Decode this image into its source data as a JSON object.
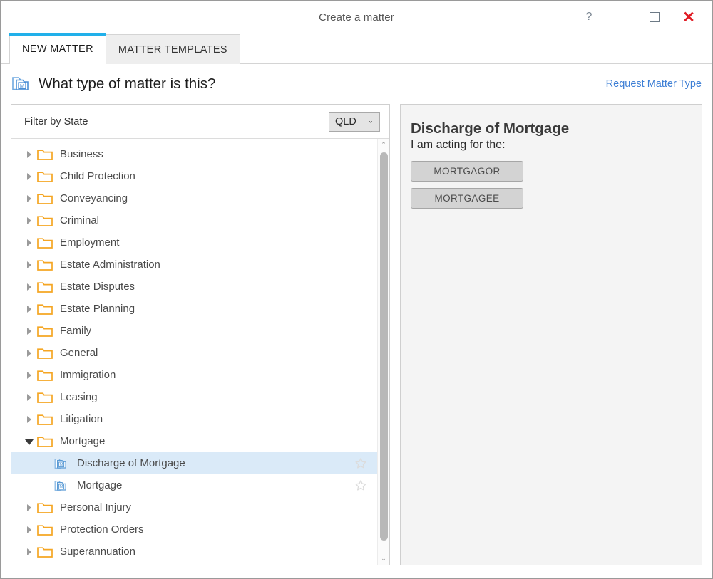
{
  "window": {
    "title": "Create a matter",
    "controls": {
      "help": "?",
      "minimize": "_",
      "maximize": "",
      "close": "✕"
    }
  },
  "tabs": [
    {
      "label": "NEW MATTER",
      "active": true
    },
    {
      "label": "MATTER TEMPLATES",
      "active": false
    }
  ],
  "header": {
    "icon": "matter-folder-icon",
    "title": "What type of matter is this?",
    "link": "Request Matter Type"
  },
  "filter": {
    "label": "Filter by State",
    "selected_state": "QLD",
    "chevron": "⌄"
  },
  "tree": {
    "items": [
      {
        "label": "Business",
        "type": "folder",
        "expanded": false,
        "level": 0
      },
      {
        "label": "Child Protection",
        "type": "folder",
        "expanded": false,
        "level": 0
      },
      {
        "label": "Conveyancing",
        "type": "folder",
        "expanded": false,
        "level": 0
      },
      {
        "label": "Criminal",
        "type": "folder",
        "expanded": false,
        "level": 0
      },
      {
        "label": "Employment",
        "type": "folder",
        "expanded": false,
        "level": 0
      },
      {
        "label": "Estate Administration",
        "type": "folder",
        "expanded": false,
        "level": 0
      },
      {
        "label": "Estate Disputes",
        "type": "folder",
        "expanded": false,
        "level": 0
      },
      {
        "label": "Estate Planning",
        "type": "folder",
        "expanded": false,
        "level": 0
      },
      {
        "label": "Family",
        "type": "folder",
        "expanded": false,
        "level": 0
      },
      {
        "label": "General",
        "type": "folder",
        "expanded": false,
        "level": 0
      },
      {
        "label": "Immigration",
        "type": "folder",
        "expanded": false,
        "level": 0
      },
      {
        "label": "Leasing",
        "type": "folder",
        "expanded": false,
        "level": 0
      },
      {
        "label": "Litigation",
        "type": "folder",
        "expanded": false,
        "level": 0
      },
      {
        "label": "Mortgage",
        "type": "folder",
        "expanded": true,
        "level": 0
      },
      {
        "label": "Discharge of Mortgage",
        "type": "matter",
        "selected": true,
        "level": 1,
        "favourite": false
      },
      {
        "label": "Mortgage",
        "type": "matter",
        "selected": false,
        "level": 1,
        "favourite": false
      },
      {
        "label": "Personal Injury",
        "type": "folder",
        "expanded": false,
        "level": 0
      },
      {
        "label": "Protection Orders",
        "type": "folder",
        "expanded": false,
        "level": 0
      },
      {
        "label": "Superannuation",
        "type": "folder",
        "expanded": false,
        "level": 0
      }
    ],
    "scrollbar": {
      "up": "⌃",
      "down": "⌄"
    }
  },
  "details": {
    "title": "Discharge of Mortgage",
    "subtitle": "I am acting for the:",
    "roles": [
      {
        "label": "MORTGAGOR"
      },
      {
        "label": "MORTGAGEE"
      }
    ]
  },
  "colors": {
    "tab_accent": "#21b0ea",
    "link": "#3e7fd5",
    "folder": "#f5a623",
    "matter_icon": "#5b9bd5",
    "selection": "#daeaf8",
    "close": "#e01b24"
  }
}
